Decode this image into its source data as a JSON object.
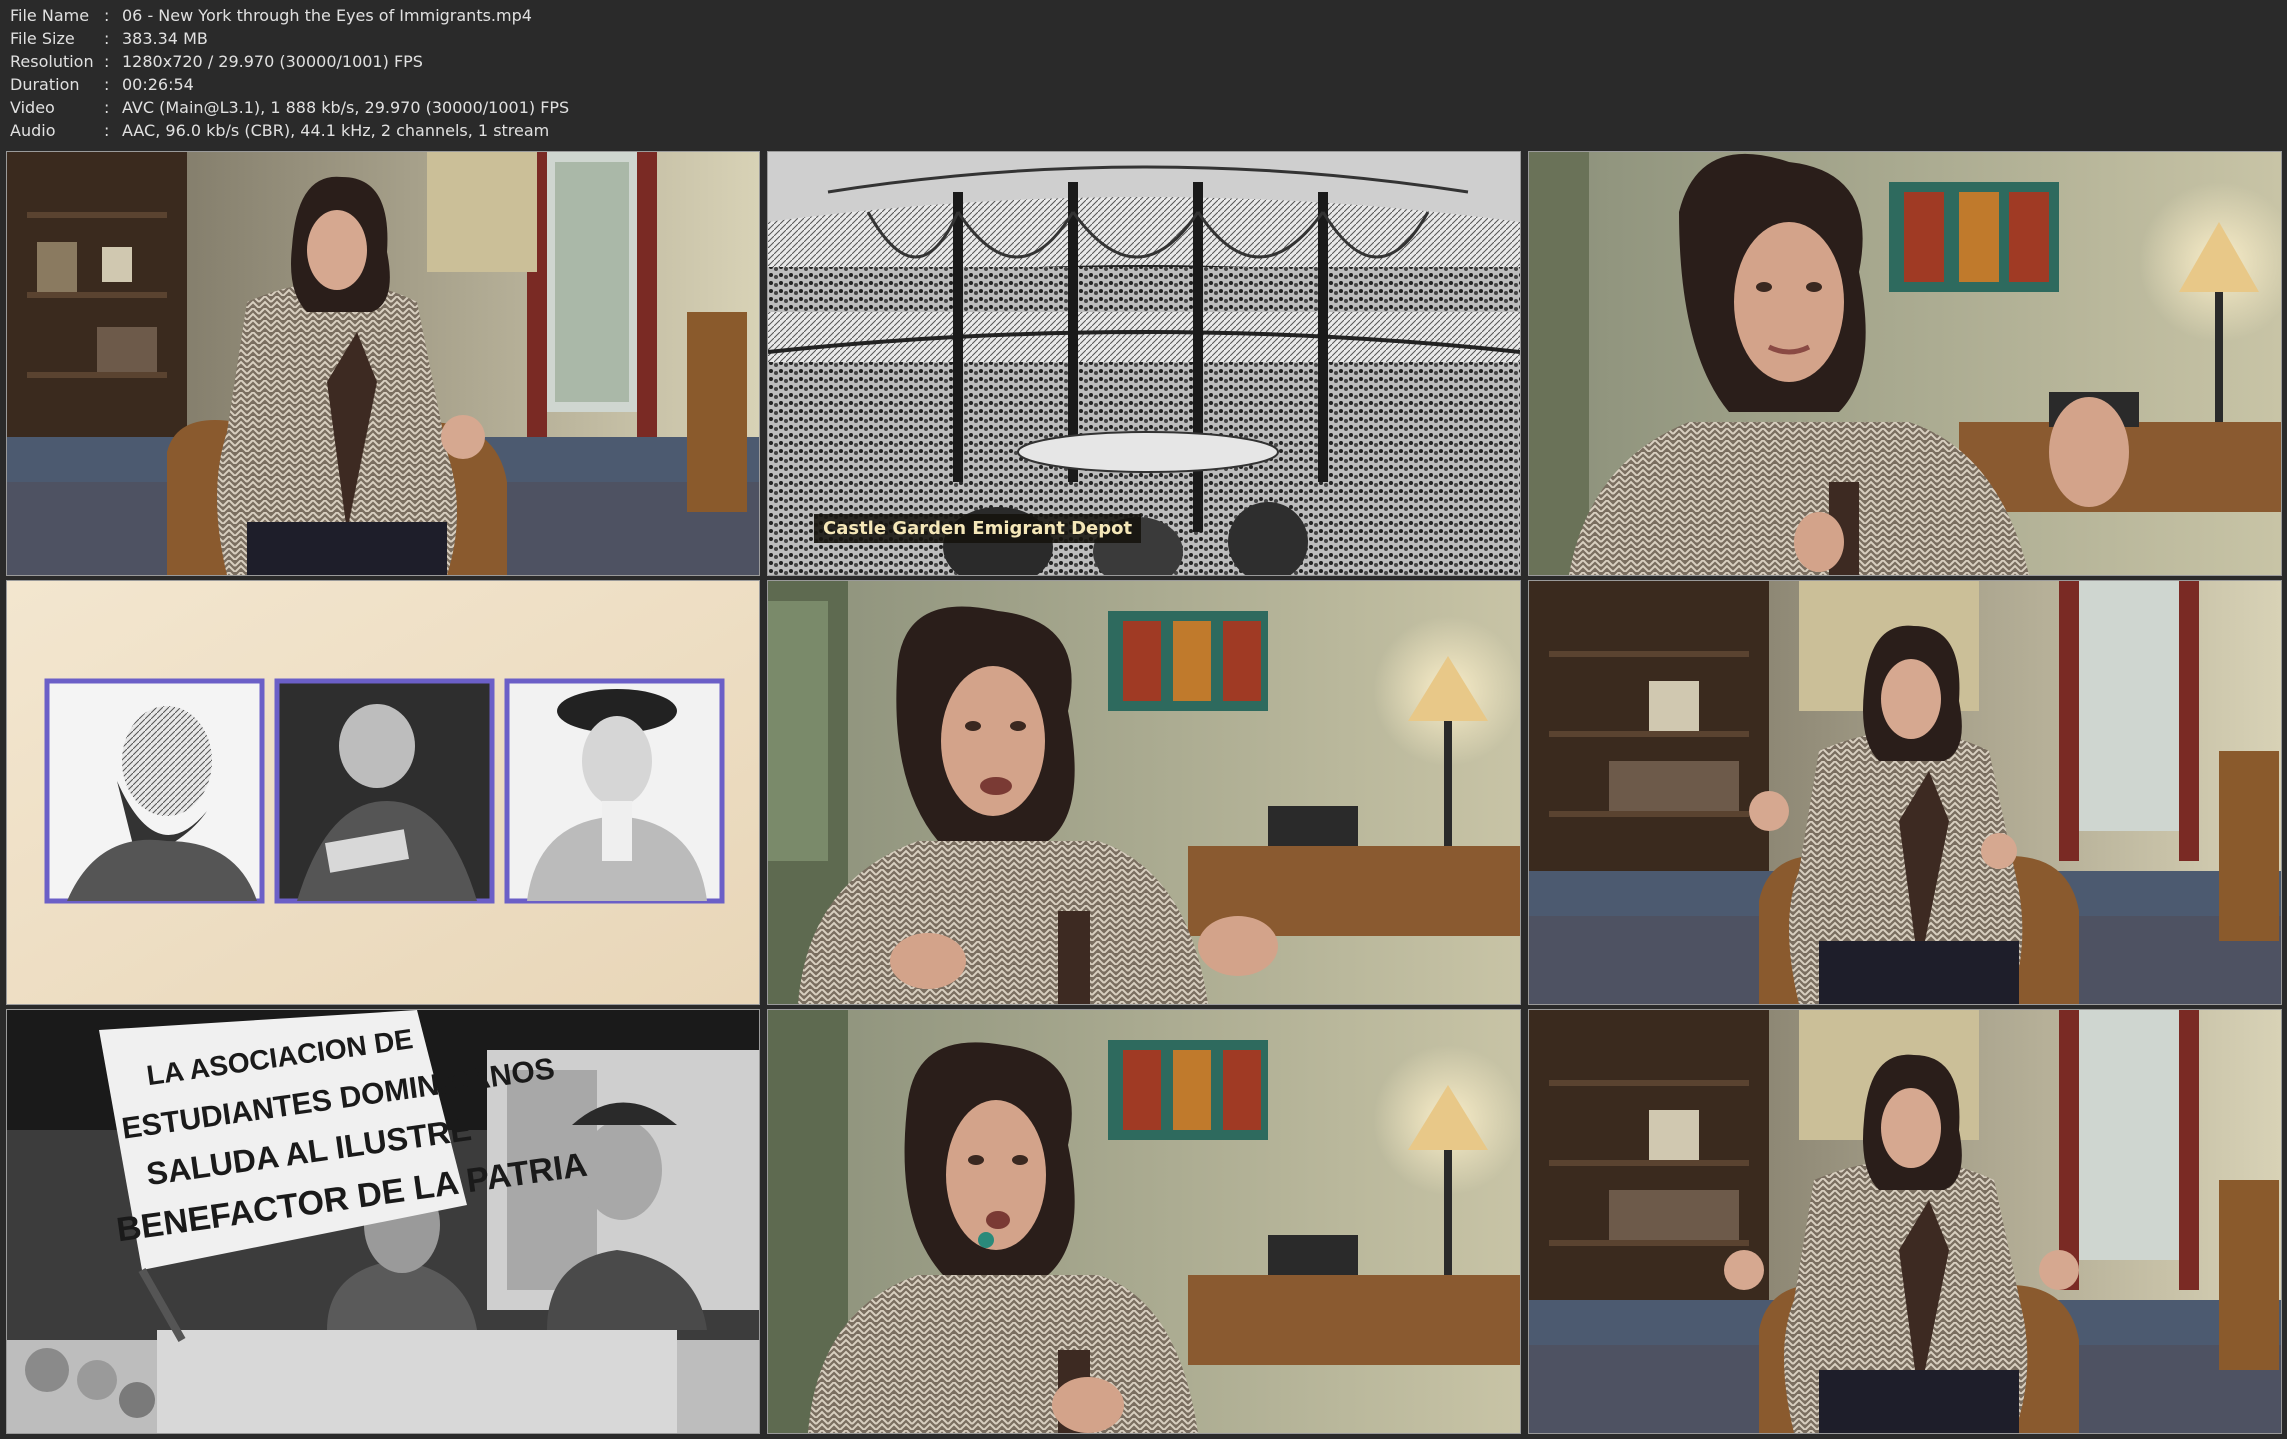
{
  "header": {
    "rows": [
      {
        "label": "File Name",
        "sep": ":",
        "value": "06 - New York through the Eyes of Immigrants.mp4"
      },
      {
        "label": "File Size",
        "sep": ":",
        "value": "383.34 MB"
      },
      {
        "label": "Resolution",
        "sep": ":",
        "value": "1280x720 / 29.970 (30000/1001) FPS"
      },
      {
        "label": "Duration",
        "sep": ":",
        "value": "00:26:54"
      },
      {
        "label": "Video",
        "sep": ":",
        "value": "AVC (Main@L3.1), 1 888 kb/s, 29.970 (30000/1001) FPS"
      },
      {
        "label": "Audio",
        "sep": ":",
        "value": "AAC, 96.0 kb/s (CBR), 44.1 kHz, 2 channels, 1 stream"
      }
    ]
  },
  "frames": {
    "f2": {
      "caption": "Castle Garden Emigrant Depot"
    },
    "f7": {
      "sign_line1": "LA ASOCIACION DE",
      "sign_line2": "ESTUDIANTES DOMINICANOS",
      "sign_line3": "SALUDA AL ILUSTRE",
      "sign_line4": "BENEFACTOR DE LA PATRIA"
    }
  },
  "colors": {
    "background": "#2a2a2a",
    "header_text": "#e0e0e0",
    "frame_border": "#9a9a9a",
    "portrait_frame": "#6b5fc7",
    "caption_text": "#f5e7b8"
  }
}
